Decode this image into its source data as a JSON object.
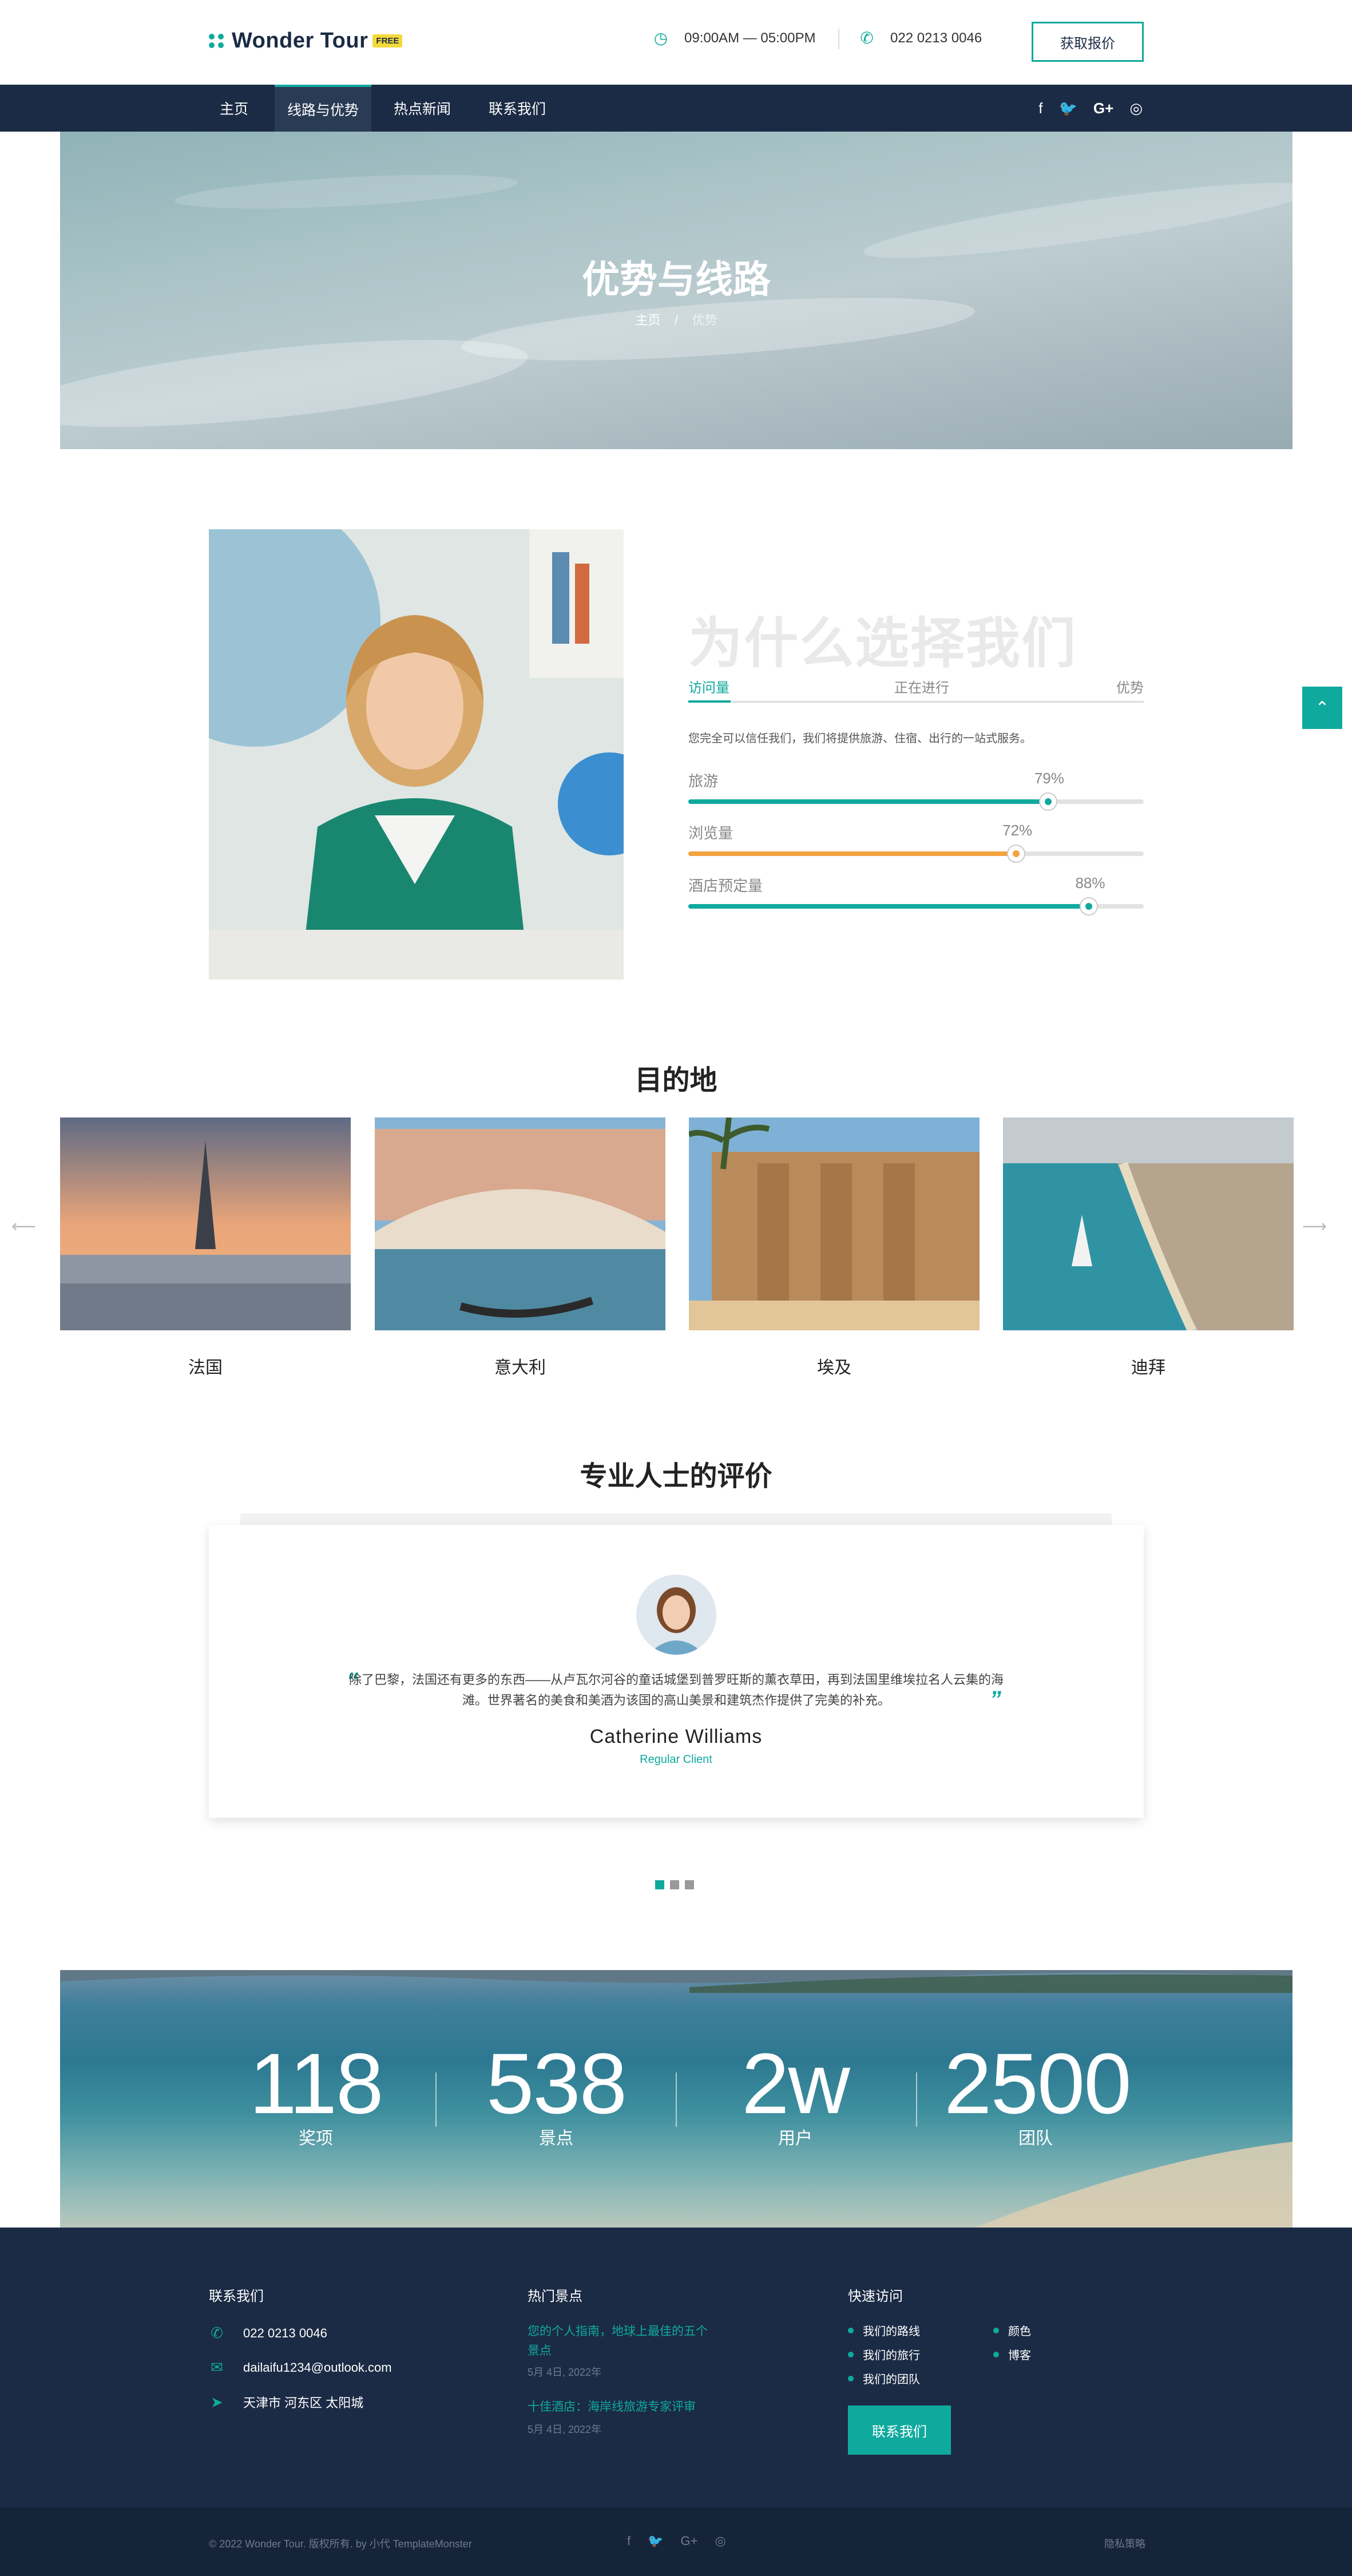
{
  "header": {
    "brand": "Wonder Tour",
    "badge": "FREE",
    "hours": "09:00AM — 05:00PM",
    "phone": "022 0213 0046",
    "quote_button": "获取报价"
  },
  "nav": {
    "items": [
      "主页",
      "线路与优势",
      "热点新闻",
      "联系我们"
    ],
    "active_index": 1
  },
  "hero": {
    "title": "优势与线路",
    "breadcrumb_home": "主页",
    "breadcrumb_sep": "/",
    "breadcrumb_current": "优势"
  },
  "why": {
    "title": "为什么选择我们",
    "tabs": [
      "访问量",
      "正在进行",
      "优势"
    ],
    "description": "您完全可以信任我们，我们将提供旅游、住宿、出行的一站式服务。",
    "bars": [
      {
        "label": "旅游",
        "percent_text": "79%",
        "value": 79,
        "color": "#10a99e"
      },
      {
        "label": "浏览量",
        "percent_text": "72%",
        "value": 72,
        "color": "#f2a340"
      },
      {
        "label": "酒店预定量",
        "percent_text": "88%",
        "value": 88,
        "color": "#10a99e"
      }
    ]
  },
  "destinations": {
    "title": "目的地",
    "items": [
      "法国",
      "意大利",
      "埃及",
      "迪拜"
    ],
    "arrow_left": "⟵",
    "arrow_right": "⟶"
  },
  "testimonials": {
    "title": "专业人士的评价",
    "text": "除了巴黎，法国还有更多的东西——从卢瓦尔河谷的童话城堡到普罗旺斯的薰衣草田，再到法国里维埃拉名人云集的海滩。世界著名的美食和美酒为该国的高山美景和建筑杰作提供了完美的补充。",
    "name": "Catherine Williams",
    "role": "Regular Client",
    "quote_open": "“",
    "quote_close": "”"
  },
  "counters": [
    {
      "value": "118",
      "label": "奖项"
    },
    {
      "value": "538",
      "label": "景点"
    },
    {
      "value": "2w",
      "label": "用户"
    },
    {
      "value": "2500",
      "label": "团队"
    }
  ],
  "footer": {
    "contact_title": "联系我们",
    "phone": "022 0213 0046",
    "email": "dailaifu1234@outlook.com",
    "address": "天津市 河东区 太阳城",
    "news_title": "热门景点",
    "news": [
      {
        "title": "您的个人指南，地球上最佳的五个景点",
        "date": "5月 4日, 2022年"
      },
      {
        "title": "十佳酒店：海岸线旅游专家评审",
        "date": "5月 4日, 2022年"
      }
    ],
    "quick_title": "快速访问",
    "links_left": [
      "我们的路线",
      "我们的旅行",
      "我们的团队"
    ],
    "links_right": [
      "颜色",
      "博客"
    ],
    "contact_button": "联系我们",
    "copyright": "© 2022 Wonder Tour. 版权所有. by 小代 TemplateMonster",
    "privacy": "隐私策略"
  }
}
